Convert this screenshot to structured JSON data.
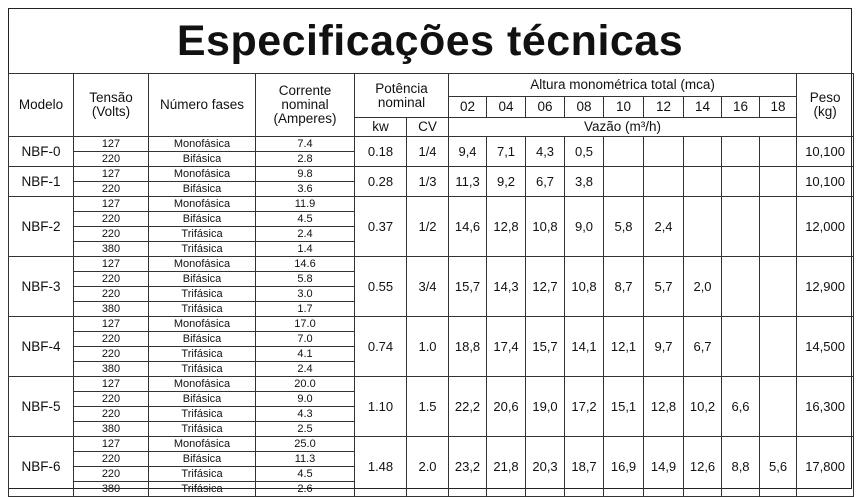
{
  "title": "Especificações técnicas",
  "headers": {
    "modelo": "Modelo",
    "tensao": "Tensão\n(Volts)",
    "numero_fases": "Número fases",
    "corrente": "Corrente\nnominal\n(Amperes)",
    "potencia": "Potência\nnominal",
    "kw": "kw",
    "cv": "CV",
    "altura": "Altura monométrica total (mca)",
    "alturas": [
      "02",
      "04",
      "06",
      "08",
      "10",
      "12",
      "14",
      "16",
      "18"
    ],
    "vazao": "Vazão (m³/h)",
    "peso": "Peso\n(kg)"
  },
  "models": [
    {
      "modelo": "NBF-0",
      "kw": "0.18",
      "cv": "1/4",
      "rows": [
        [
          "127",
          "Monofásica",
          "7.4"
        ],
        [
          "220",
          "Bifásica",
          "2.8"
        ]
      ],
      "vazao": [
        "9,4",
        "7,1",
        "4,3",
        "0,5",
        "",
        "",
        "",
        "",
        ""
      ],
      "peso": "10,100"
    },
    {
      "modelo": "NBF-1",
      "kw": "0.28",
      "cv": "1/3",
      "rows": [
        [
          "127",
          "Monofásica",
          "9.8"
        ],
        [
          "220",
          "Bifásica",
          "3.6"
        ]
      ],
      "vazao": [
        "11,3",
        "9,2",
        "6,7",
        "3,8",
        "",
        "",
        "",
        "",
        ""
      ],
      "peso": "10,100"
    },
    {
      "modelo": "NBF-2",
      "kw": "0.37",
      "cv": "1/2",
      "rows": [
        [
          "127",
          "Monofásica",
          "11.9"
        ],
        [
          "220",
          "Bifásica",
          "4.5"
        ],
        [
          "220",
          "Trifásica",
          "2.4"
        ],
        [
          "380",
          "Trifásica",
          "1.4"
        ]
      ],
      "vazao": [
        "14,6",
        "12,8",
        "10,8",
        "9,0",
        "5,8",
        "2,4",
        "",
        "",
        ""
      ],
      "peso": "12,000"
    },
    {
      "modelo": "NBF-3",
      "kw": "0.55",
      "cv": "3/4",
      "rows": [
        [
          "127",
          "Monofásica",
          "14.6"
        ],
        [
          "220",
          "Bifásica",
          "5.8"
        ],
        [
          "220",
          "Trifásica",
          "3.0"
        ],
        [
          "380",
          "Trifásica",
          "1.7"
        ]
      ],
      "vazao": [
        "15,7",
        "14,3",
        "12,7",
        "10,8",
        "8,7",
        "5,7",
        "2,0",
        "",
        ""
      ],
      "peso": "12,900"
    },
    {
      "modelo": "NBF-4",
      "kw": "0.74",
      "cv": "1.0",
      "rows": [
        [
          "127",
          "Monofásica",
          "17.0"
        ],
        [
          "220",
          "Bifásica",
          "7.0"
        ],
        [
          "220",
          "Trifásica",
          "4.1"
        ],
        [
          "380",
          "Trifásica",
          "2.4"
        ]
      ],
      "vazao": [
        "18,8",
        "17,4",
        "15,7",
        "14,1",
        "12,1",
        "9,7",
        "6,7",
        "",
        ""
      ],
      "peso": "14,500"
    },
    {
      "modelo": "NBF-5",
      "kw": "1.10",
      "cv": "1.5",
      "rows": [
        [
          "127",
          "Monofásica",
          "20.0"
        ],
        [
          "220",
          "Bifásica",
          "9.0"
        ],
        [
          "220",
          "Trifásica",
          "4.3"
        ],
        [
          "380",
          "Trifásica",
          "2.5"
        ]
      ],
      "vazao": [
        "22,2",
        "20,6",
        "19,0",
        "17,2",
        "15,1",
        "12,8",
        "10,2",
        "6,6",
        ""
      ],
      "peso": "16,300"
    },
    {
      "modelo": "NBF-6",
      "kw": "1.48",
      "cv": "2.0",
      "rows": [
        [
          "127",
          "Monofásica",
          "25.0"
        ],
        [
          "220",
          "Bifásica",
          "11.3"
        ],
        [
          "220",
          "Trifásica",
          "4.5"
        ],
        [
          "380",
          "Trifásica",
          "2.6"
        ]
      ],
      "vazao": [
        "23,2",
        "21,8",
        "20,3",
        "18,7",
        "16,9",
        "14,9",
        "12,6",
        "8,8",
        "5,6"
      ],
      "peso": "17,800"
    }
  ]
}
